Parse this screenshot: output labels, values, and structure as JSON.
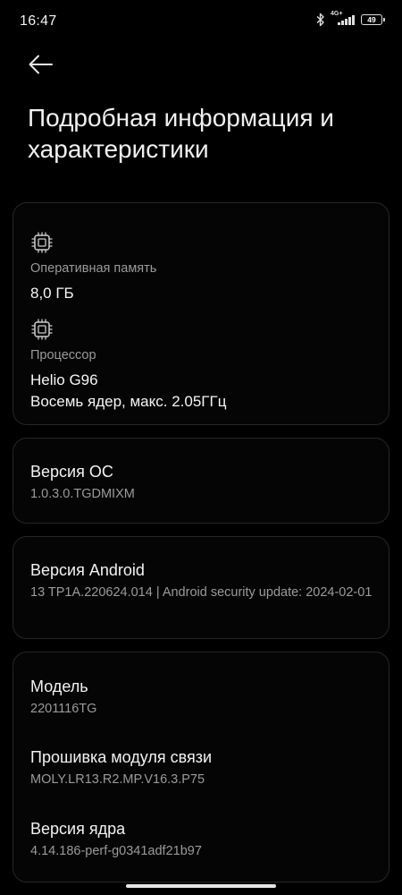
{
  "status_bar": {
    "time": "16:47",
    "network": "4G+",
    "battery": "49",
    "icons": [
      "bluetooth-icon",
      "signal-icon",
      "battery-icon"
    ]
  },
  "header": {
    "back_icon": "back-arrow-icon",
    "title": "Подробная информация и характеристики"
  },
  "hardware": {
    "ram": {
      "label": "Оперативная память",
      "value": "8,0 ГБ",
      "icon": "memory-chip-icon"
    },
    "cpu": {
      "label": "Процессор",
      "value": "Helio G96",
      "detail": "Восемь ядер, макс. 2.05ГГц",
      "icon": "processor-chip-icon"
    }
  },
  "os": {
    "title": "Версия ОС",
    "value": "1.0.3.0.TGDMIXM"
  },
  "android": {
    "title": "Версия Android",
    "value": "13 TP1A.220624.014 | Android security update: 2024-02-01"
  },
  "device": {
    "model": {
      "title": "Модель",
      "value": "2201116TG"
    },
    "baseband": {
      "title": "Прошивка модуля связи",
      "value": "MOLY.LR13.R2.MP.V16.3.P75"
    },
    "kernel": {
      "title": "Версия ядра",
      "value": "4.14.186-perf-g0341adf21b97"
    }
  },
  "colors": {
    "background": "#000000",
    "card_border": "#262626",
    "secondary_text": "#9a9a9a"
  }
}
